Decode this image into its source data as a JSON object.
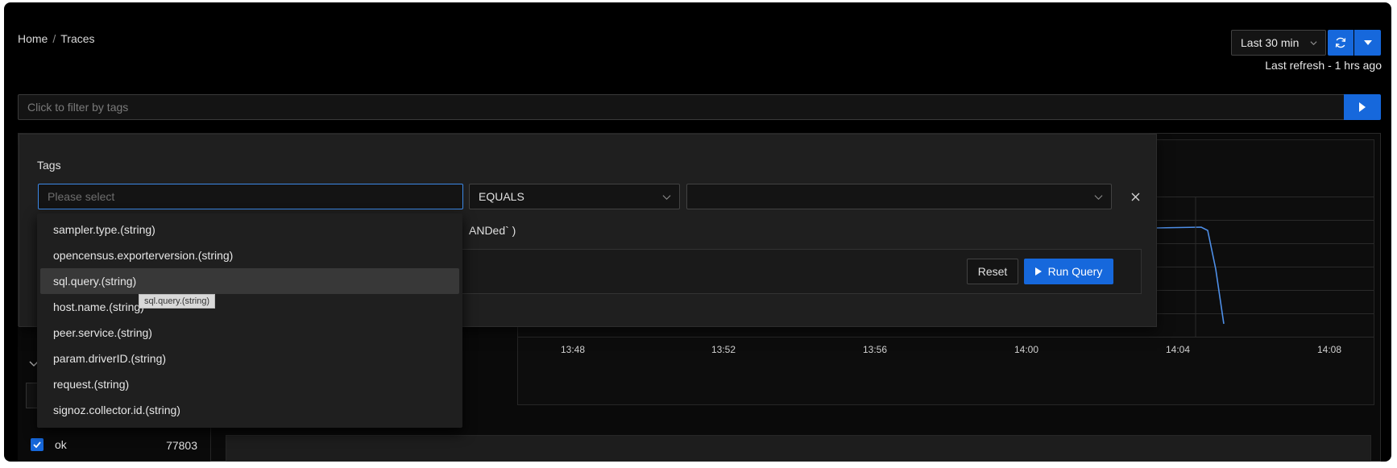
{
  "header": {
    "breadcrumb": {
      "home": "Home",
      "separator": "/",
      "current": "Traces"
    },
    "time_range": "Last 30 min",
    "last_refresh": "Last refresh - 1 hrs ago"
  },
  "filter_bar": {
    "placeholder": "Click to filter by tags"
  },
  "tags_panel": {
    "title": "Tags",
    "key_placeholder": "Please select",
    "operator": "EQUALS",
    "value": "",
    "hint": "ANDed` )",
    "reset_label": "Reset",
    "run_label": "Run Query"
  },
  "tag_options": [
    "sampler.type.(string)",
    "opencensus.exporterversion.(string)",
    "sql.query.(string)",
    "host.name.(string)",
    "peer.service.(string)",
    "param.driverID.(string)",
    "request.(string)",
    "signoz.collector.id.(string)"
  ],
  "tooltip": "sql.query.(string)",
  "chart": {
    "x_ticks": [
      "13:48",
      "13:52",
      "13:56",
      "14:00",
      "14:04",
      "14:08"
    ]
  },
  "status_filter": {
    "label": "ok",
    "count": "77803",
    "checked": true
  },
  "colors": {
    "accent": "#1668dc",
    "focus_border": "#3c89e8",
    "line": "#4e8fe8"
  }
}
